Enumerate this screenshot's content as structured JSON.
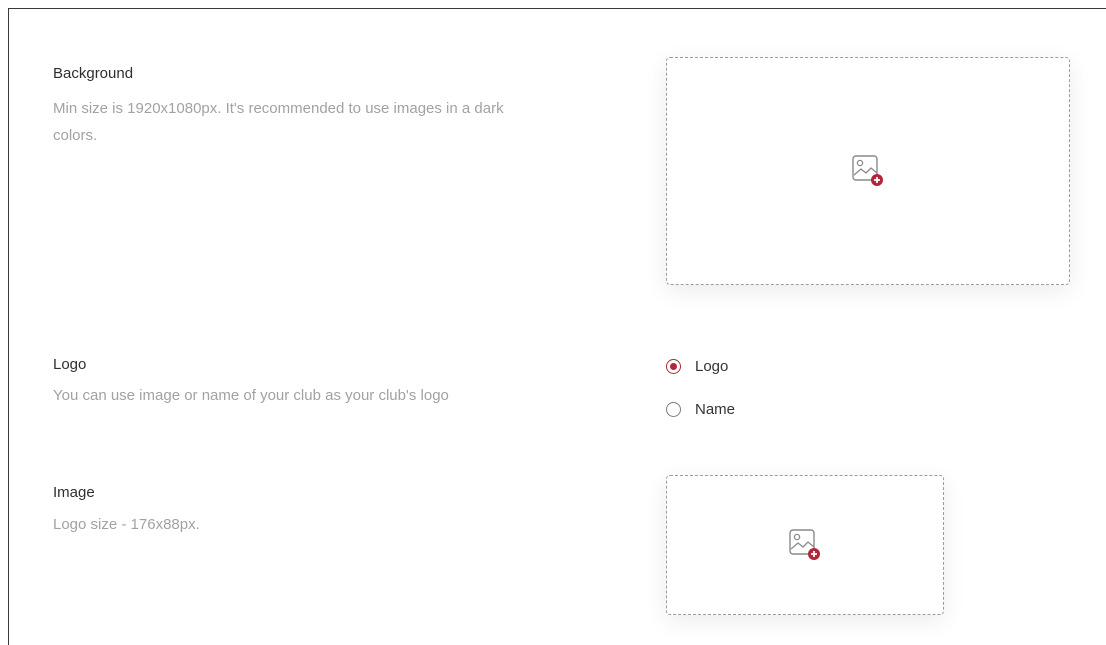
{
  "background": {
    "title": "Background",
    "description_line1": "Min size is 1920x1080px. It's recommended to use images in a dark",
    "description_line2": "colors.",
    "upload_icon": "image-add-icon"
  },
  "logo": {
    "title": "Logo",
    "description": "You can use image or name of your club as your club's logo",
    "options": [
      {
        "label": "Logo",
        "selected": true
      },
      {
        "label": "Name",
        "selected": false
      }
    ]
  },
  "image": {
    "title": "Image",
    "description": "Logo size - 176x88px.",
    "upload_icon": "image-add-icon"
  },
  "colors": {
    "accent": "#b1263a",
    "muted_text": "#a2a2a2",
    "dashed_border": "#9b9b9b"
  }
}
